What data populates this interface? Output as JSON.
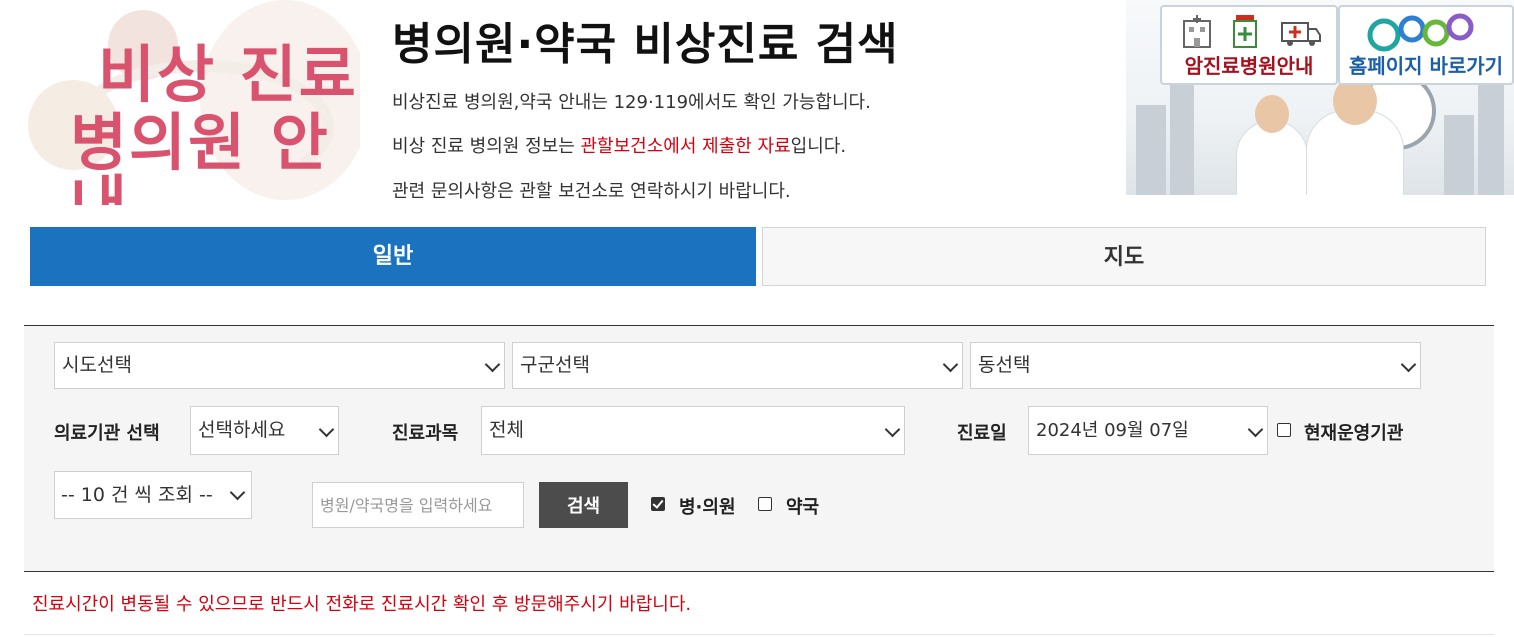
{
  "logo": {
    "line1": "비상 진료",
    "line2": "병의원 안내"
  },
  "header": {
    "title": "병의원·약국 비상진료 검색",
    "notices": [
      {
        "before": "비상진료 병의원,약국 안내는 129·119에서도 확인 가능합니다.",
        "highlight": "",
        "after": ""
      },
      {
        "before": "비상 진료 병의원 정보는 ",
        "highlight": "관할보건소에서 제출한 자료",
        "after": "입니다."
      },
      {
        "before": "관련 문의사항은 관할 보건소로 연락하시기 바랍니다.",
        "highlight": "",
        "after": ""
      }
    ]
  },
  "right_banner": {
    "cancer_hospital_label": "암진료병원안내",
    "homepage_label": "홈페이지 바로가기"
  },
  "tabs": [
    {
      "label": "일반",
      "active": true
    },
    {
      "label": "지도",
      "active": false
    }
  ],
  "search": {
    "sido": "시도선택",
    "gugun": "구군선택",
    "dong": "동선택",
    "institution_label": "의료기관 선택",
    "institution_value": "선택하세요",
    "department_label": "진료과목",
    "department_value": "전체",
    "date_label": "진료일",
    "date_value": "2024년 09월 07일",
    "operating_label": "현재운영기관",
    "operating_checked": false,
    "page_size": "-- 10 건 씩 조회 --",
    "name_placeholder": "병원/약국명을 입력하세요",
    "search_button": "검색",
    "hospital_label": "병·의원",
    "hospital_checked": true,
    "pharmacy_label": "약국",
    "pharmacy_checked": false
  },
  "warning": "진료시간이 변동될 수 있으므로 반드시 전화로 진료시간 확인 후 방문해주시기 바랍니다.",
  "colors": {
    "accent": "#1b73c0",
    "highlight": "#d7000f",
    "logo_pink": "#d9536f",
    "search_button": "#4c4c4c"
  }
}
